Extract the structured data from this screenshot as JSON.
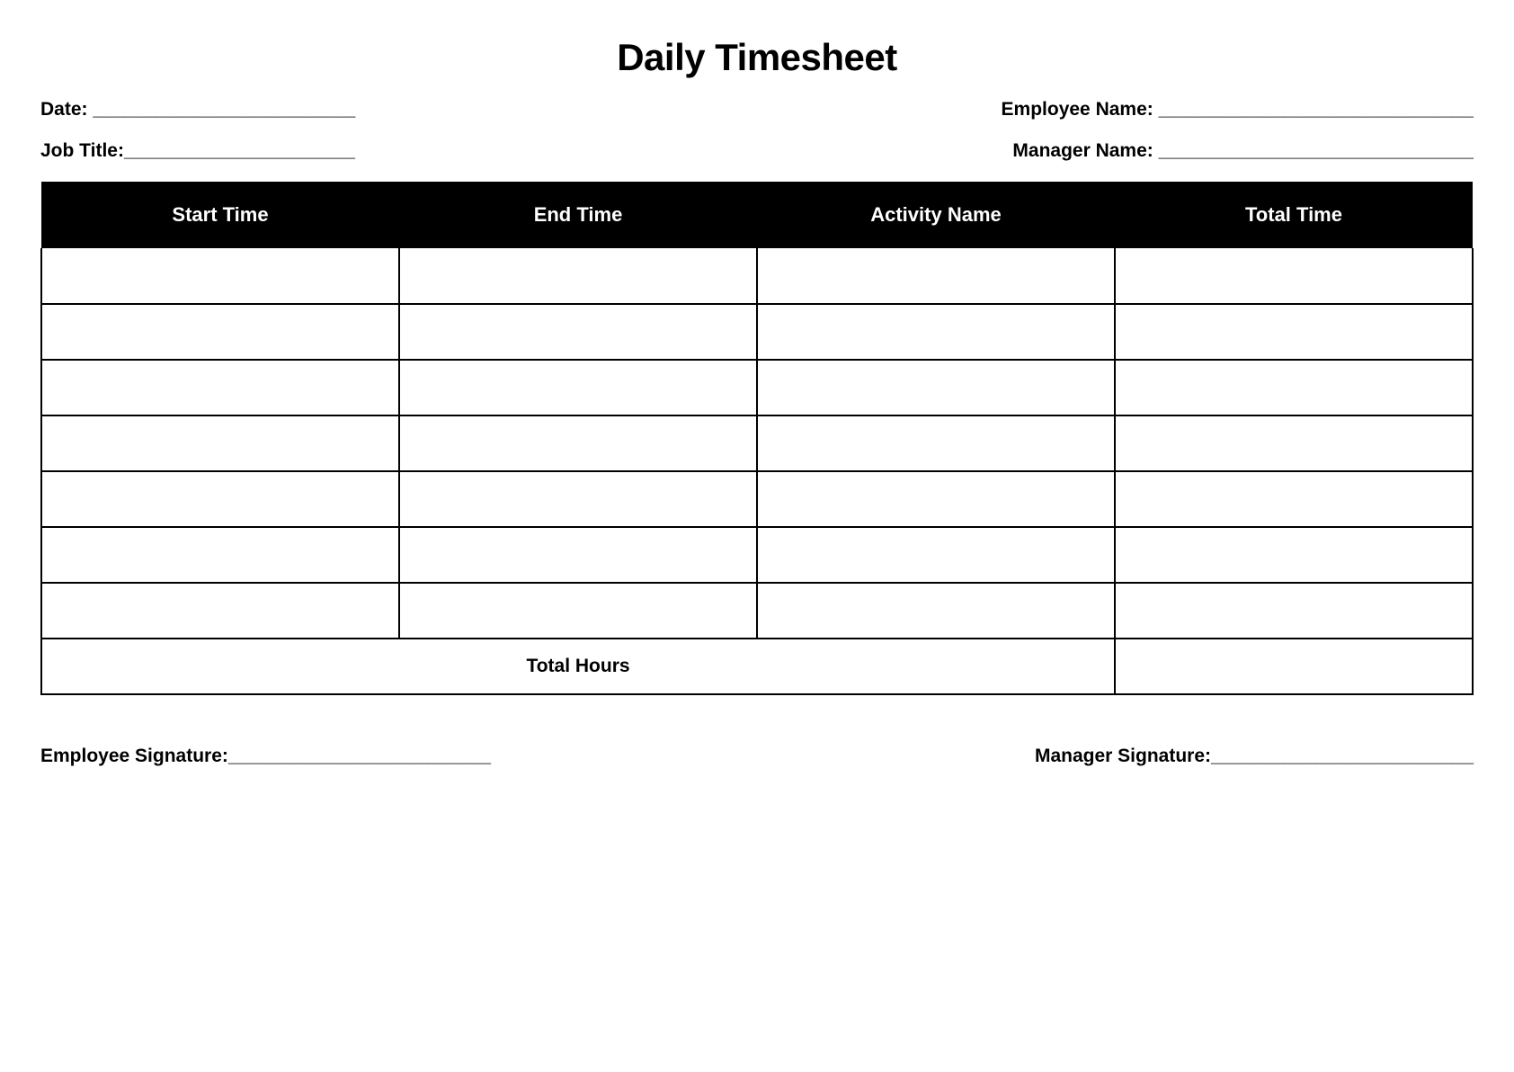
{
  "title": "Daily Timesheet",
  "fields": {
    "date": {
      "label": "Date: ",
      "line": "_________________________"
    },
    "employee_name": {
      "label": "Employee Name: ",
      "line": "______________________________"
    },
    "job_title": {
      "label": "Job Title:",
      "line": "______________________"
    },
    "manager_name": {
      "label": "Manager Name: ",
      "line": "______________________________"
    },
    "employee_signature": {
      "label": "Employee Signature:",
      "line": "_________________________"
    },
    "manager_signature": {
      "label": "Manager Signature:",
      "line": "_________________________"
    }
  },
  "table": {
    "headers": [
      "Start Time",
      "End Time",
      "Activity Name",
      "Total Time"
    ],
    "rows": [
      {
        "start_time": "",
        "end_time": "",
        "activity_name": "",
        "total_time": ""
      },
      {
        "start_time": "",
        "end_time": "",
        "activity_name": "",
        "total_time": ""
      },
      {
        "start_time": "",
        "end_time": "",
        "activity_name": "",
        "total_time": ""
      },
      {
        "start_time": "",
        "end_time": "",
        "activity_name": "",
        "total_time": ""
      },
      {
        "start_time": "",
        "end_time": "",
        "activity_name": "",
        "total_time": ""
      },
      {
        "start_time": "",
        "end_time": "",
        "activity_name": "",
        "total_time": ""
      },
      {
        "start_time": "",
        "end_time": "",
        "activity_name": "",
        "total_time": ""
      }
    ],
    "total_hours_label": "Total Hours",
    "total_hours_value": ""
  }
}
